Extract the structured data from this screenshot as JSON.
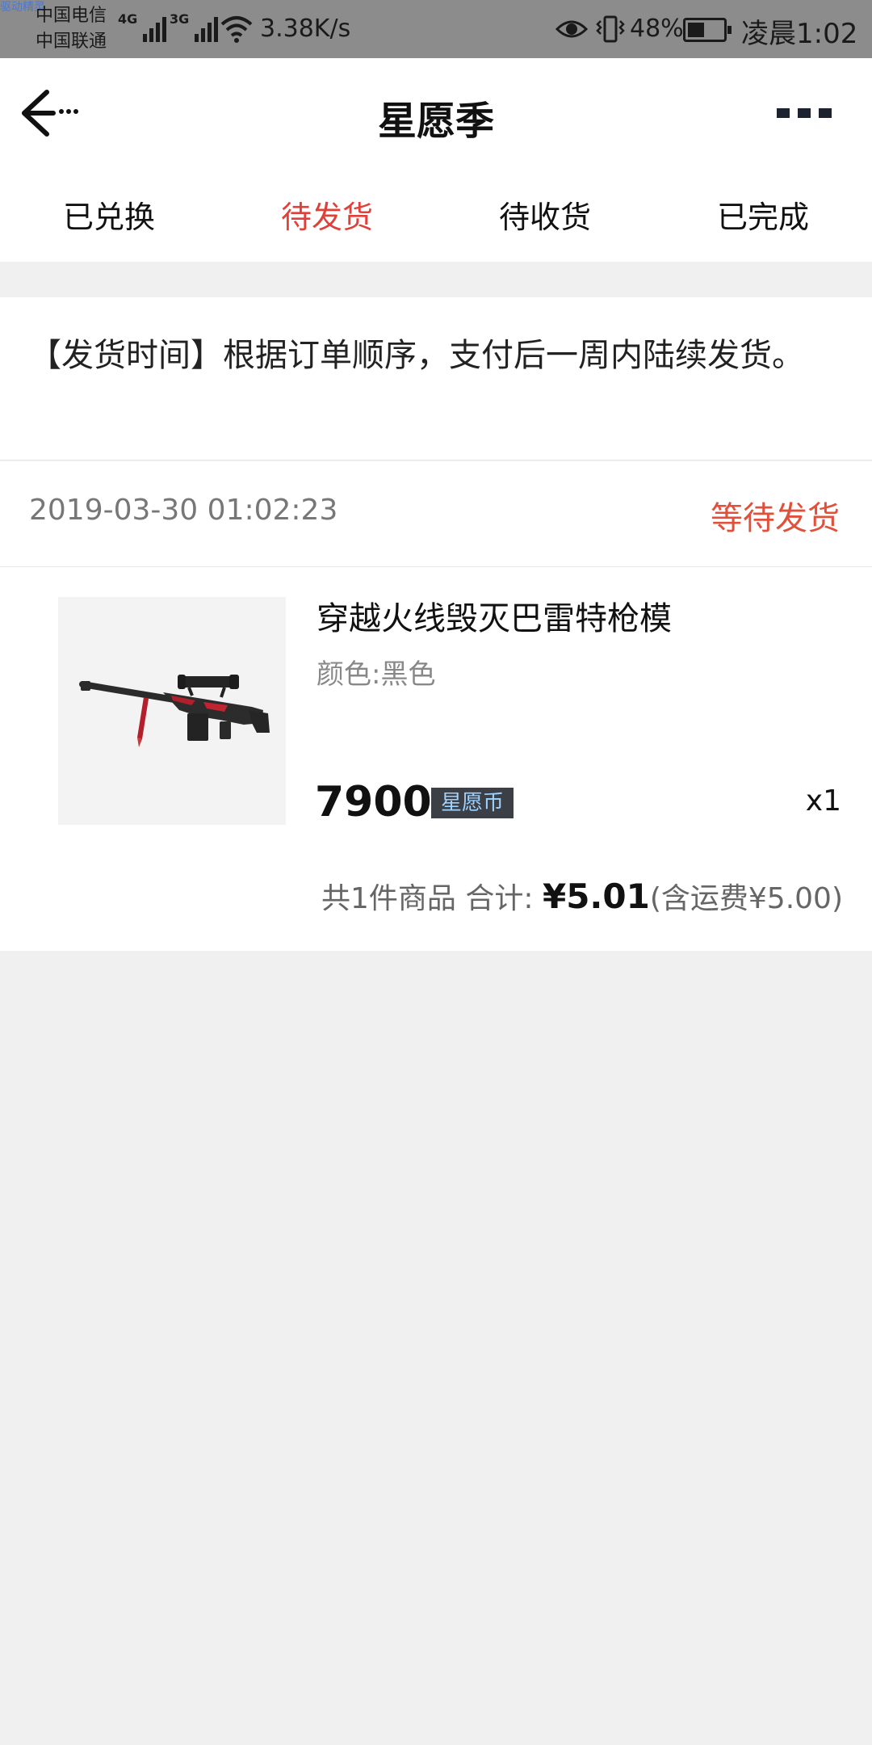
{
  "status_bar": {
    "tiny_label": "驱动精灵",
    "carrier_1": "中国电信",
    "carrier_2": "中国联通",
    "sim1_network": "4G",
    "sim2_network": "3G",
    "net_speed": "3.38K/s",
    "battery_percent": "48%",
    "battery_level": 0.48,
    "time": "凌晨1:02"
  },
  "nav": {
    "title": "星愿季",
    "icons": [
      "back-arrow-icon",
      "more-dots-icon"
    ]
  },
  "tabs": [
    {
      "label": "已兑换",
      "active": false
    },
    {
      "label": "待发货",
      "active": true
    },
    {
      "label": "待收货",
      "active": false
    },
    {
      "label": "已完成",
      "active": false
    }
  ],
  "notice": {
    "text": "【发货时间】根据订单顺序，支付后一周内陆续发货。"
  },
  "order": {
    "time": "2019-03-30 01:02:23",
    "status": "等待发货",
    "product": {
      "name": "穿越火线毁灭巴雷特枪模",
      "spec": "颜色:黑色",
      "price": "7900",
      "currency_badge": "星愿币",
      "quantity": "x1"
    },
    "summary": {
      "count_text": "共1件商品",
      "total_label": "合计:",
      "total": "¥5.01",
      "shipping_note": "(含运费¥5.00)"
    }
  },
  "colors": {
    "accent_red": "#e0403a",
    "status_orange_red": "#e0503a",
    "status_bar_bg": "#8c8c8c",
    "page_bg": "#f0f0f0",
    "badge_bg": "#3c3f45",
    "badge_text": "#9ed2ff"
  }
}
